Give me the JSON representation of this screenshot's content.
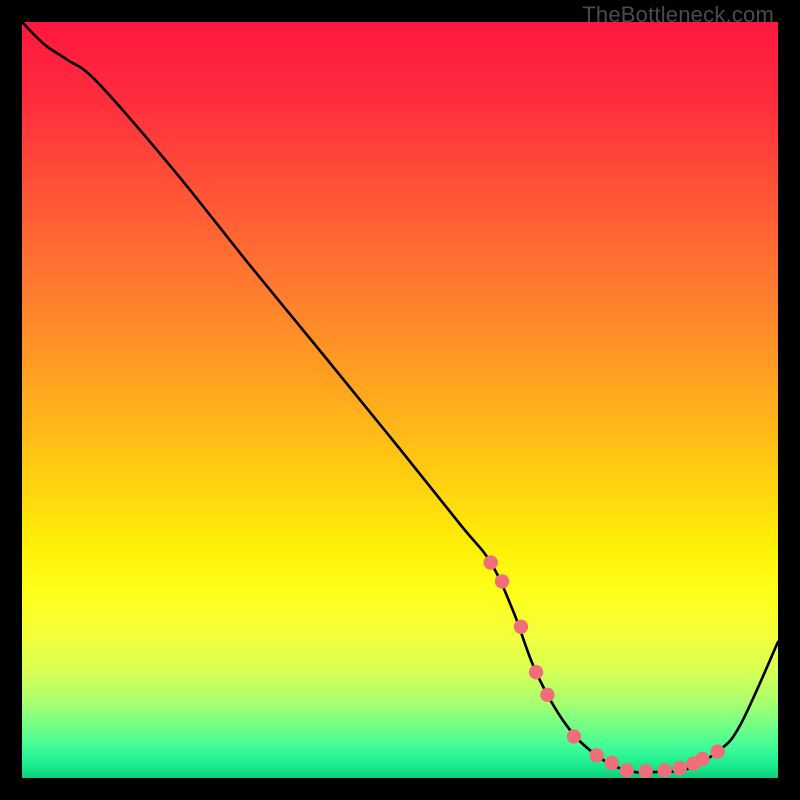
{
  "watermark": "TheBottleneck.com",
  "chart_data": {
    "type": "line",
    "title": "",
    "xlabel": "",
    "ylabel": "",
    "xlim": [
      0,
      100
    ],
    "ylim": [
      0,
      100
    ],
    "x": [
      0,
      3,
      6,
      10,
      20,
      30,
      40,
      50,
      58,
      62,
      65,
      68,
      72,
      76,
      80,
      84,
      88,
      92,
      95,
      100
    ],
    "y": [
      100,
      97,
      95,
      92,
      80.5,
      68,
      55.8,
      43.5,
      33.5,
      28.5,
      22,
      14,
      7,
      3,
      1,
      0.8,
      1.2,
      3.5,
      7,
      18
    ],
    "markers": {
      "x": [
        62,
        63.5,
        66,
        68,
        69.5,
        73,
        76,
        78,
        80,
        82.5,
        85,
        87,
        88.8,
        90,
        92
      ],
      "y": [
        28.5,
        26,
        20,
        14,
        11,
        5.5,
        3,
        2,
        1,
        0.9,
        1,
        1.3,
        1.9,
        2.5,
        3.5
      ]
    },
    "gradient_stops": [
      {
        "offset": 0.0,
        "color": "#ff173f"
      },
      {
        "offset": 0.1,
        "color": "#ff2c3d"
      },
      {
        "offset": 0.22,
        "color": "#ff5237"
      },
      {
        "offset": 0.35,
        "color": "#ff7a30"
      },
      {
        "offset": 0.48,
        "color": "#ffa41f"
      },
      {
        "offset": 0.6,
        "color": "#ffce10"
      },
      {
        "offset": 0.7,
        "color": "#fff208"
      },
      {
        "offset": 0.76,
        "color": "#feff1e"
      },
      {
        "offset": 0.81,
        "color": "#f4ff3a"
      },
      {
        "offset": 0.86,
        "color": "#d6ff55"
      },
      {
        "offset": 0.9,
        "color": "#a8ff6e"
      },
      {
        "offset": 0.93,
        "color": "#74ff86"
      },
      {
        "offset": 0.96,
        "color": "#3efc97"
      },
      {
        "offset": 0.985,
        "color": "#17e98e"
      },
      {
        "offset": 1.0,
        "color": "#0bce78"
      }
    ],
    "marker_color": "#ef6e7a",
    "curve_color": "#000000"
  }
}
